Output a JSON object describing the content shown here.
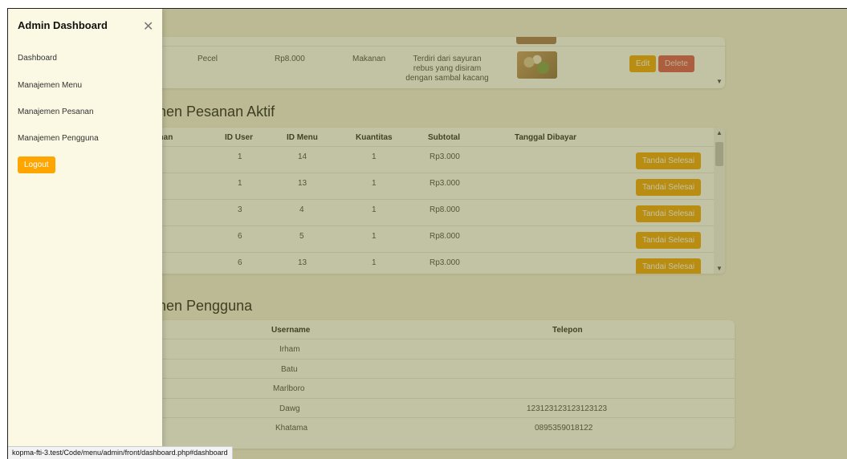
{
  "sidebar": {
    "title": "Admin Dashboard",
    "close_icon": "close-icon",
    "items": [
      {
        "label": "Dashboard"
      },
      {
        "label": "Manajemen Menu"
      },
      {
        "label": "Manajemen Pesanan"
      },
      {
        "label": "Manajemen Pengguna"
      }
    ],
    "logout_label": "Logout"
  },
  "menu_table": {
    "row": {
      "name": "Pecel",
      "price": "Rp8.000",
      "category": "Makanan",
      "description": "Terdiri dari sayuran rebus yang disiram dengan sambal kacang",
      "image": "pecel-food-image"
    },
    "edit_label": "Edit",
    "delete_label": "Delete"
  },
  "orders": {
    "title": "men Pesanan Aktif",
    "headers": {
      "col0": "anan",
      "id_user": "ID User",
      "id_menu": "ID Menu",
      "kuantitas": "Kuantitas",
      "subtotal": "Subtotal",
      "tanggal": "Tanggal Dibayar"
    },
    "action_label": "Tandai Selesai",
    "rows": [
      {
        "id_user": "1",
        "id_menu": "14",
        "qty": "1",
        "subtotal": "Rp3.000"
      },
      {
        "id_user": "1",
        "id_menu": "13",
        "qty": "1",
        "subtotal": "Rp3.000"
      },
      {
        "id_user": "3",
        "id_menu": "4",
        "qty": "1",
        "subtotal": "Rp8.000"
      },
      {
        "id_user": "6",
        "id_menu": "5",
        "qty": "1",
        "subtotal": "Rp8.000"
      },
      {
        "id_user": "6",
        "id_menu": "13",
        "qty": "1",
        "subtotal": "Rp3.000"
      }
    ]
  },
  "users": {
    "title": "men Pengguna",
    "headers": {
      "username": "Username",
      "telepon": "Telepon"
    },
    "rows": [
      {
        "username": "Irham",
        "telepon": ""
      },
      {
        "username": "Batu",
        "telepon": ""
      },
      {
        "username": "Marlboro",
        "telepon": ""
      },
      {
        "username": "Dawg",
        "telepon": "123123123123123123"
      },
      {
        "username": "Khatama",
        "telepon": "0895359018122"
      }
    ]
  },
  "status_bar": {
    "url": "kopma-fti-3.test/Code/menu/admin/front/dashboard.php#dashboard"
  },
  "colors": {
    "accent": "#ffa500",
    "delete": "#d9534f",
    "sidebar_bg": "#fbf9e3"
  }
}
